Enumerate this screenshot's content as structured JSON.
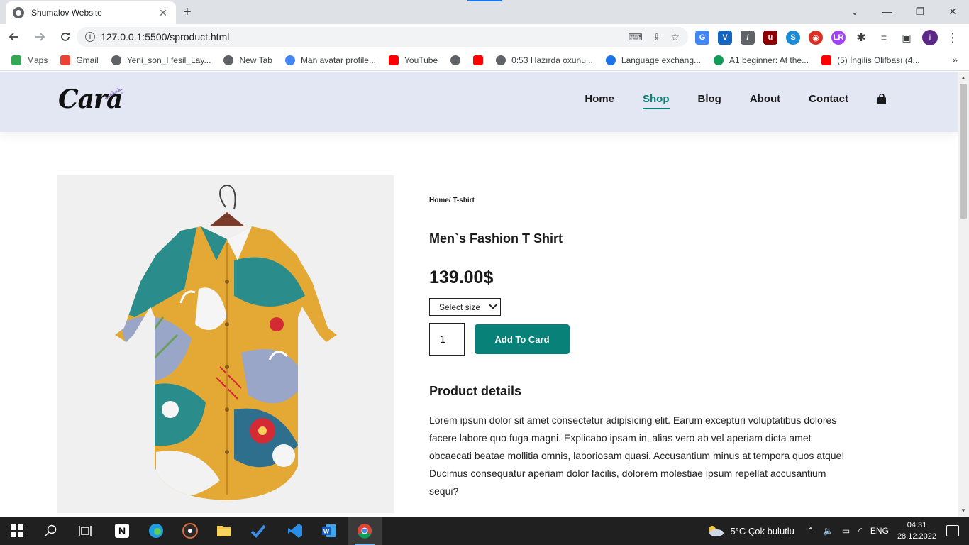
{
  "browser": {
    "tab_title": "Shumalov Website",
    "tab_close": "✕",
    "new_tab": "+",
    "url": "127.0.0.1:5500/sproduct.html",
    "window_controls": [
      "⌄",
      "—",
      "❐",
      "✕"
    ],
    "profile_initial": "i",
    "bookmarks": [
      {
        "label": "Maps",
        "color": "#34a853"
      },
      {
        "label": "Gmail",
        "color": "#ea4335"
      },
      {
        "label": "Yeni_son_I fesil_Lay...",
        "color": "#5f6368"
      },
      {
        "label": "New Tab",
        "color": "#5f6368"
      },
      {
        "label": "Man avatar profile...",
        "color": "#4285f4"
      },
      {
        "label": "YouTube",
        "color": "#ff0000"
      },
      {
        "label": "",
        "color": "#5f6368"
      },
      {
        "label": "",
        "color": "#ff0000"
      },
      {
        "label": "0:53 Hazırda oxunu...",
        "color": "#5f6368"
      },
      {
        "label": "Language exchang...",
        "color": "#1a73e8"
      },
      {
        "label": "A1 beginner: At the...",
        "color": "#0f9d58"
      },
      {
        "label": "(5) İngilis Əlifbası (4...",
        "color": "#ff0000"
      }
    ],
    "bookmarks_more": "»"
  },
  "site": {
    "logo": "Cara",
    "nav": [
      "Home",
      "Shop",
      "Blog",
      "About",
      "Contact"
    ],
    "active_nav": "Shop"
  },
  "product": {
    "breadcrumb": "Home/ T-shirt",
    "title": "Men`s Fashion T Shirt",
    "price": "139.00$",
    "size_select": "Select size",
    "quantity": "1",
    "add_button": "Add To Card",
    "details_heading": "Product details",
    "description": "Lorem ipsum dolor sit amet consectetur adipisicing elit. Earum excepturi voluptatibus dolores facere labore quo fuga magni. Explicabo ipsam in, alias vero ab vel aperiam dicta amet obcaecati beatae mollitia omnis, laboriosam quasi. Accusantium minus at tempora quos atque! Ducimus consequatur aperiam dolor facilis, dolorem molestiae ipsum repellat accusantium sequi?"
  },
  "taskbar": {
    "weather": "5°C  Çok bulutlu",
    "language": "ENG",
    "time": "04:31",
    "date": "28.12.2022"
  },
  "colors": {
    "accent": "#088178",
    "header_bg": "#e3e6f3"
  }
}
